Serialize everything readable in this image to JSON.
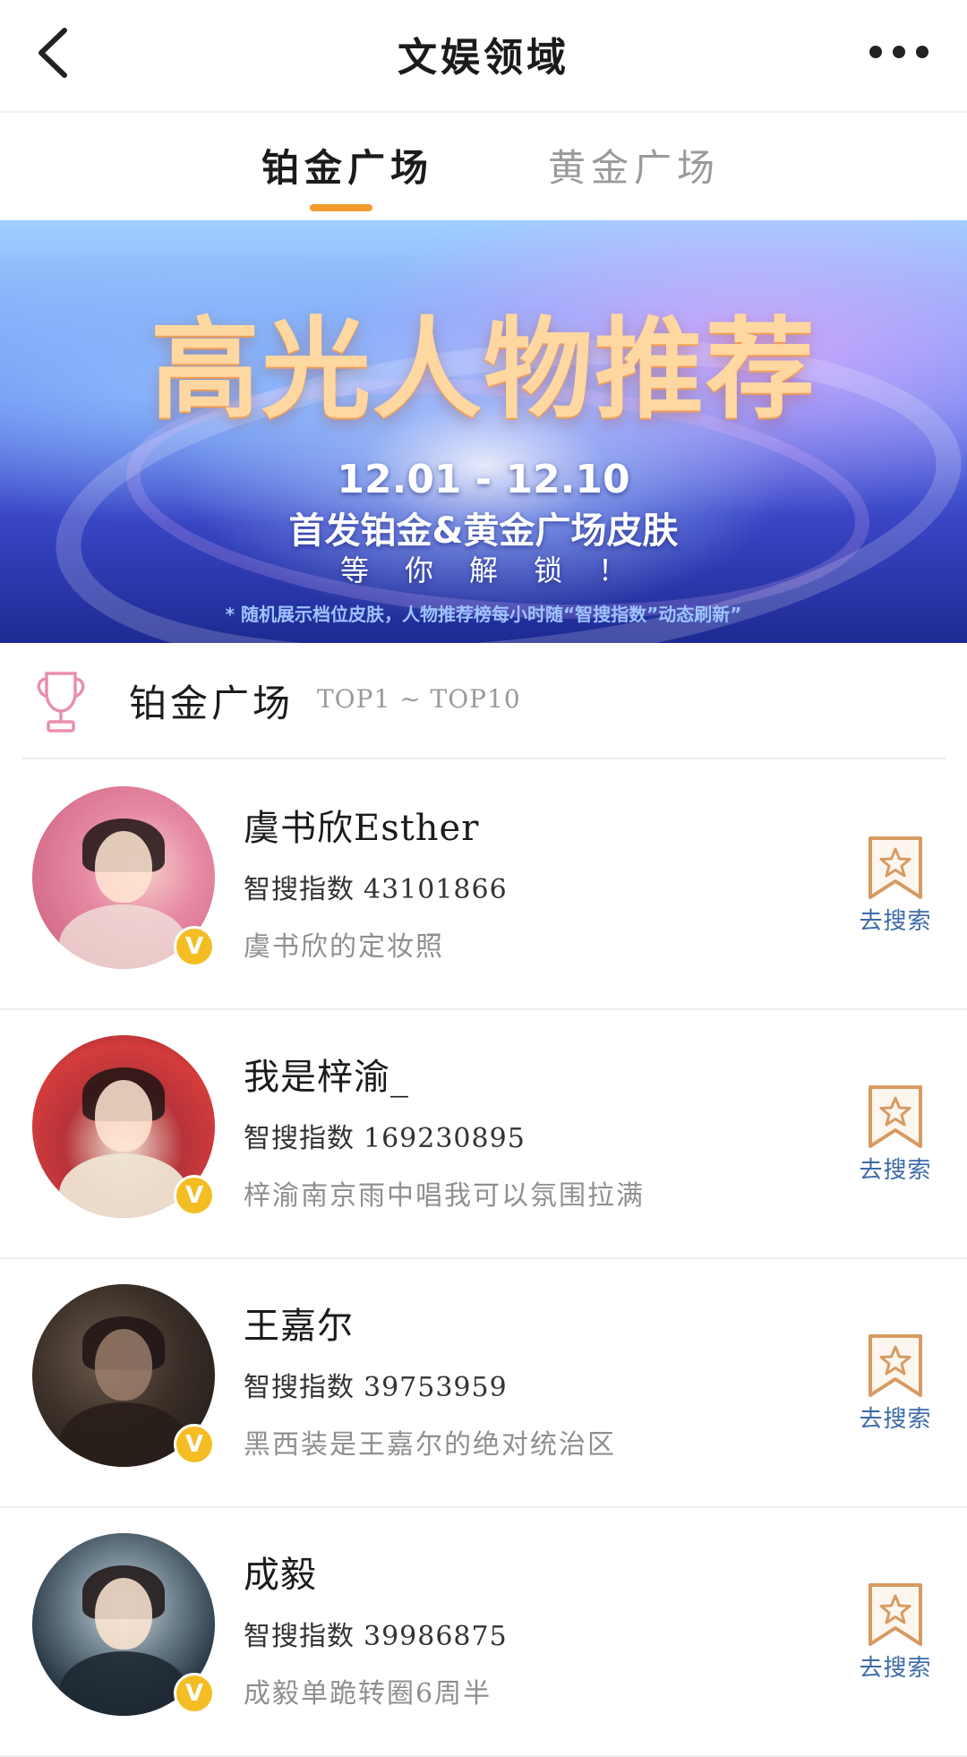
{
  "header": {
    "title": "文娱领域",
    "back_icon": "chevron-left-icon",
    "more_icon": "more-horizontal-icon"
  },
  "tabs": [
    {
      "label": "铂金广场",
      "active": true
    },
    {
      "label": "黄金广场",
      "active": false
    }
  ],
  "banner": {
    "title": "高光人物推荐",
    "dates": "12.01 - 12.10",
    "subtitle": "首发铂金&黄金广场皮肤",
    "cta": "等你解锁！",
    "note": "* 随机展示档位皮肤，人物推荐榜每小时随“智搜指数”动态刷新”"
  },
  "section": {
    "title": "铂金广场",
    "range": "TOP1 ~ TOP10",
    "icon": "trophy-icon"
  },
  "items": [
    {
      "name": "虞书欣Esther",
      "index_label": "智搜指数",
      "index_value": "43101866",
      "desc": "虞书欣的定妆照",
      "badge": "V",
      "action": "去搜索"
    },
    {
      "name": "我是梓渝_",
      "index_label": "智搜指数",
      "index_value": "169230895",
      "desc": "梓渝南京雨中唱我可以氛围拉满",
      "badge": "V",
      "action": "去搜索"
    },
    {
      "name": "王嘉尔",
      "index_label": "智搜指数",
      "index_value": "39753959",
      "desc": "黑西装是王嘉尔的绝对统治区",
      "badge": "V",
      "action": "去搜索"
    },
    {
      "name": "成毅",
      "index_label": "智搜指数",
      "index_value": "39986875",
      "desc": "成毅单跪转圈6周半",
      "badge": "V",
      "action": "去搜索"
    }
  ],
  "colors": {
    "accent": "#f19a2d",
    "link": "#3d6aa8",
    "badge": "#f4bd23",
    "trophy": "#e98fae"
  }
}
